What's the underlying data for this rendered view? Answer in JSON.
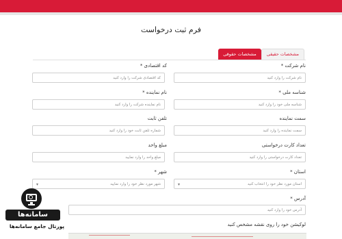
{
  "form": {
    "title": "فرم ثبت درخواست",
    "tabs": [
      {
        "label": "مشخصات حقیقی",
        "active": false
      },
      {
        "label": "مشخصات حقوقی",
        "active": true
      }
    ]
  },
  "fields": {
    "company_name": {
      "label": "نام شرکت *",
      "placeholder": "نام شرکت را وارد کنید"
    },
    "economic_code": {
      "label": "کد اقتصادی *",
      "placeholder": "کد اقتصادی شرکت را وارد کنید"
    },
    "national_id": {
      "label": "شناسه ملی *",
      "placeholder": "شناسه ملی خود را وارد کنید"
    },
    "rep_name": {
      "label": "نام نماینده *",
      "placeholder": "نام نماینده شرکت را وارد کنید"
    },
    "rep_position": {
      "label": "سمت نماینده",
      "placeholder": "سمت نماینده را وارد کنید"
    },
    "landline": {
      "label": "تلفن ثابت",
      "placeholder": "شماره تلفن ثابت خود را وارد کنید"
    },
    "card_count": {
      "label": "تعداد کارت درخواستی",
      "placeholder": "تعداد کارت درخواستی را وارد کنید"
    },
    "unit_amount": {
      "label": "مبلغ واحد",
      "placeholder": "مبلغ واحد را وارد نمایید"
    },
    "province": {
      "label": "استان *",
      "placeholder": "استان مورد نظر خود را انتخاب کنید",
      "caret": "▾"
    },
    "city": {
      "label": "شهر *",
      "placeholder": "شهر مورد نظر خود را وارد نمایید",
      "caret": "▾"
    },
    "address": {
      "label": "آدرس *",
      "placeholder": "آدرس خود را وارد کنید"
    },
    "location": {
      "label": "لوکیشن خود را روی نقشه مشخص کنید"
    }
  },
  "logo": {
    "name": "سامانه‌ها",
    "subtitle": "پورتال جامع سامانه‌ها"
  },
  "colors": {
    "accent": "#d81b37"
  }
}
